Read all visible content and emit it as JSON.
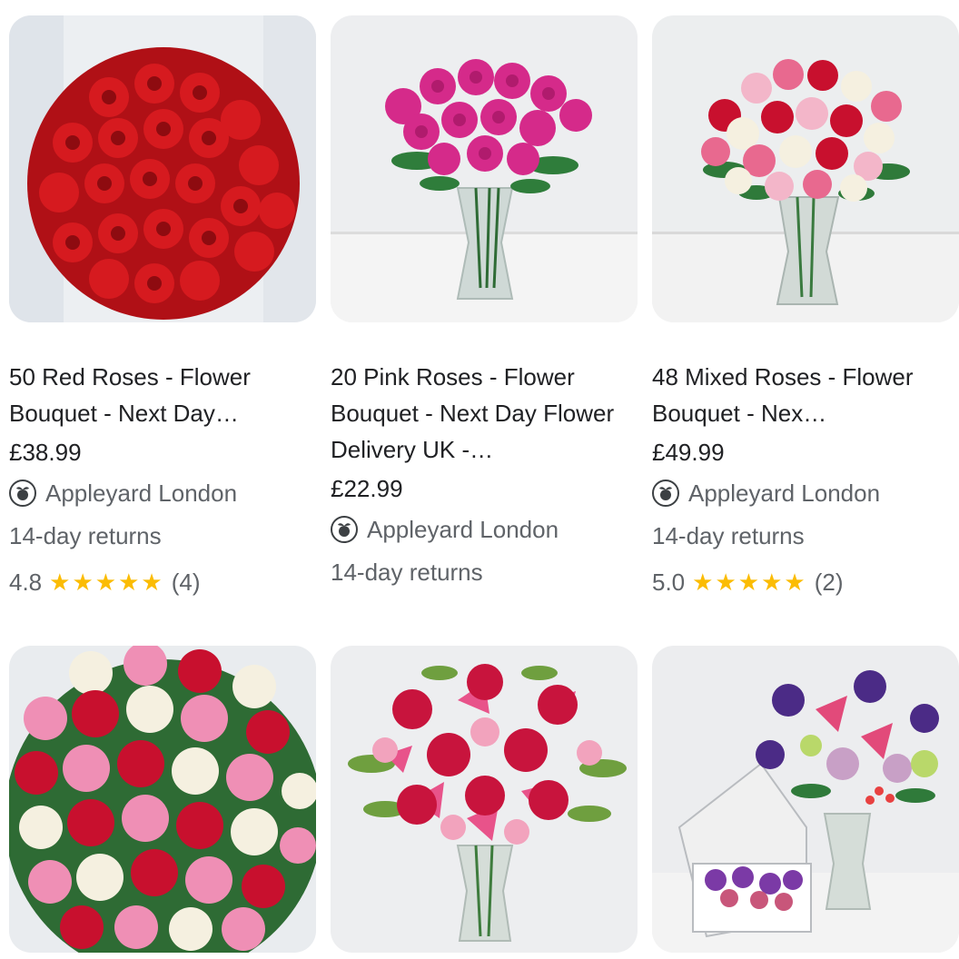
{
  "products": [
    {
      "title": "50 Red Roses - Flower Bouquet - Next Day…",
      "price": "£38.99",
      "seller": "Appleyard London",
      "returns": "14-day returns",
      "rating": "4.8",
      "stars": "★★★★★",
      "reviews": "(4)",
      "image_icon": "red-roses-bouquet-image"
    },
    {
      "title": "20 Pink Roses - Flower Bouquet - Next Day Flower Delivery UK -…",
      "price": "£22.99",
      "seller": "Appleyard London",
      "returns": "14-day returns",
      "image_icon": "pink-roses-vase-image"
    },
    {
      "title": "48 Mixed Roses - Flower Bouquet - Nex…",
      "price": "£49.99",
      "seller": "Appleyard London",
      "returns": "14-day returns",
      "rating": "5.0",
      "stars": "★★★★★",
      "reviews": "(2)",
      "image_icon": "mixed-roses-vase-image"
    },
    {
      "image_icon": "pink-red-white-roses-image"
    },
    {
      "image_icon": "lilies-and-roses-vase-image"
    },
    {
      "image_icon": "letterbox-flowers-vase-image"
    }
  ],
  "colors": {
    "star": "#fbbc04",
    "text": "#202124",
    "muted": "#5f6368"
  }
}
